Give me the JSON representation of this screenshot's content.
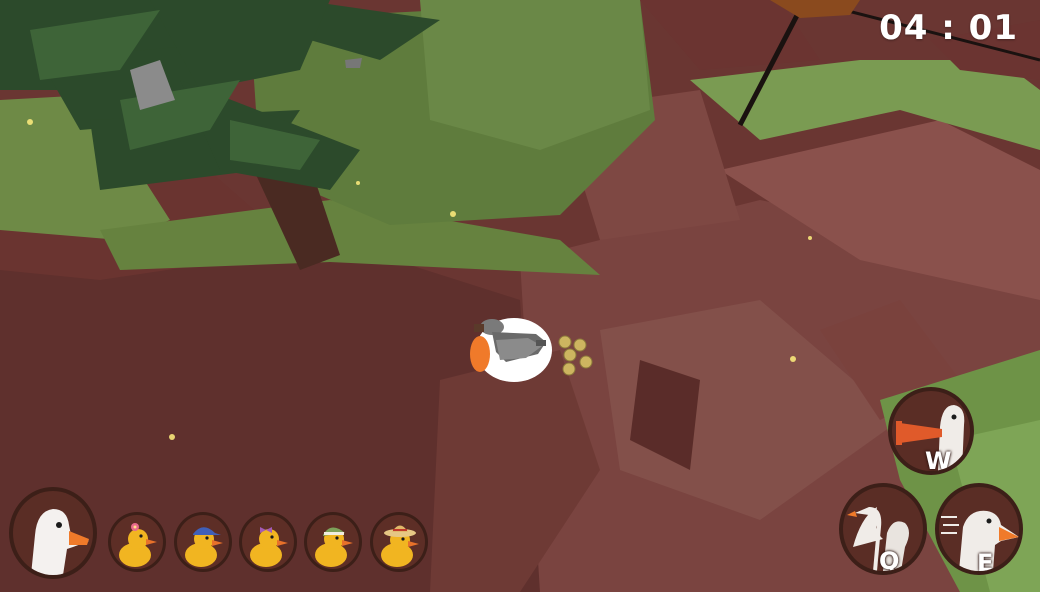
{
  "hud": {
    "timer": "04 : 01",
    "player": {
      "icon": "goose-head-icon"
    },
    "ducklings": [
      {
        "name": "duckling-flower",
        "accessory": "pink-flower"
      },
      {
        "name": "duckling-cap",
        "accessory": "blue-cap"
      },
      {
        "name": "duckling-bow",
        "accessory": "purple-bow"
      },
      {
        "name": "duckling-beanie",
        "accessory": "green-beanie"
      },
      {
        "name": "duckling-straw-hat",
        "accessory": "straw-hat"
      }
    ],
    "abilities": [
      {
        "name": "honk",
        "key": "W",
        "icon": "honk-trumpet-icon"
      },
      {
        "name": "flap",
        "key": "Q",
        "icon": "goose-flap-icon"
      },
      {
        "name": "dash",
        "key": "E",
        "icon": "goose-dash-icon"
      }
    ]
  },
  "colors": {
    "terrain": "#7a3d37",
    "grass": "#6d8b46",
    "tree": "#2d4a2c",
    "goose": "#ffffff",
    "beak": "#f07a2a",
    "duck": "#f1b521",
    "hud_ring": "#3c1f18"
  }
}
